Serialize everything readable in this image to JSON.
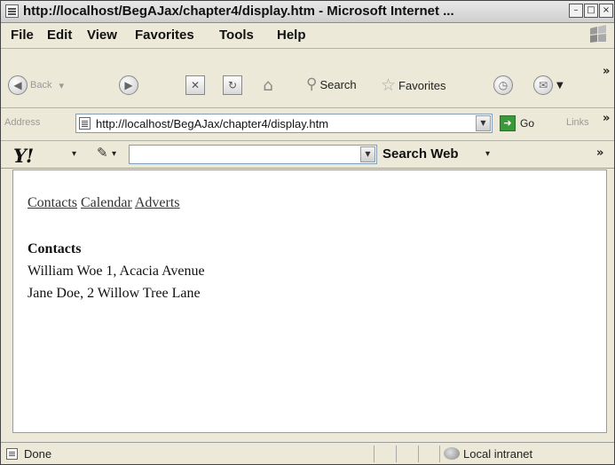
{
  "window": {
    "title": "http://localhost/BegAJax/chapter4/display.htm - Microsoft Internet ..."
  },
  "menubar": {
    "items": [
      "File",
      "Edit",
      "View",
      "Favorites",
      "Tools",
      "Help"
    ]
  },
  "toolbar": {
    "back_label": "Back",
    "search_label": "Search",
    "favorites_label": "Favorites"
  },
  "addressbar": {
    "label": "Address",
    "url": "http://localhost/BegAJax/chapter4/display.htm",
    "go_label": "Go",
    "links_label": "Links"
  },
  "yahoo_toolbar": {
    "logo": "Y!",
    "search_placeholder": "",
    "search_button": "Search Web"
  },
  "page": {
    "nav_links": [
      "Contacts",
      "Calendar",
      "Adverts"
    ],
    "section_heading": "Contacts",
    "contacts": [
      "William Woe 1, Acacia Avenue",
      "Jane Doe, 2 Willow Tree Lane"
    ]
  },
  "statusbar": {
    "status": "Done",
    "zone": "Local intranet"
  },
  "colors": {
    "link": "#333333",
    "chrome": "#ece9d8",
    "content_bg": "#ffffff"
  }
}
